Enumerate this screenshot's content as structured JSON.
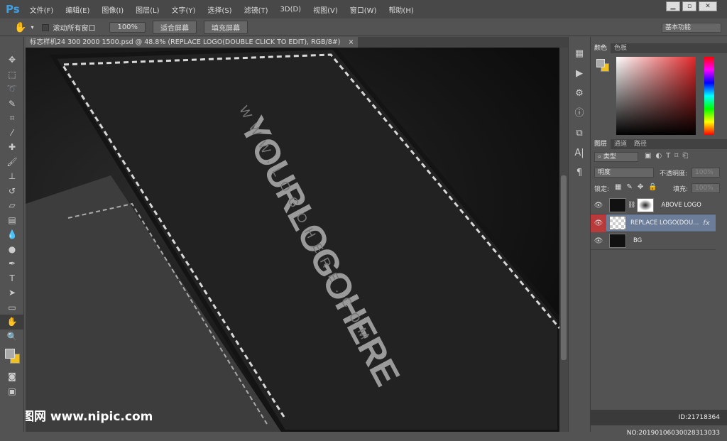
{
  "app": {
    "logo": "Ps"
  },
  "menu": [
    "文件(F)",
    "编辑(E)",
    "图像(I)",
    "图层(L)",
    "文字(Y)",
    "选择(S)",
    "滤镜(T)",
    "3D(D)",
    "视图(V)",
    "窗口(W)",
    "帮助(H)"
  ],
  "window_controls": {
    "minimize": "▁",
    "restore": "▫",
    "close": "✕"
  },
  "options": {
    "scroll_all_label": "滚动所有窗口",
    "zoom100": "100%",
    "fit_screen": "适合屏幕",
    "fill_screen": "填充屏幕",
    "workspace": "基本功能"
  },
  "document_tab": {
    "title": "标志样机24 300 2000 1500.psd @ 48.8% (REPLACE LOGO(DOUBLE CLICK TO EDIT), RGB/8#)",
    "close": "×"
  },
  "canvas": {
    "logo_text": "YOURLOGOHERE",
    "url_text": "WWW.LOGOHERE.COM"
  },
  "color_panel": {
    "tabs": [
      "颜色",
      "色板"
    ]
  },
  "layers_panel": {
    "tabs": [
      "图层",
      "通道",
      "路径"
    ],
    "filter_kind": "类型",
    "blend_mode": "明度",
    "opacity_label": "不透明度:",
    "opacity": "100%",
    "lock_label": "锁定:",
    "fill_label": "填充:",
    "fill": "100%",
    "layers": [
      {
        "name": "ABOVE LOGO",
        "selected": false
      },
      {
        "name": "REPLACE LOGO(DOU...",
        "selected": true,
        "fx": "fx"
      },
      {
        "name": "BG",
        "selected": false
      }
    ]
  },
  "watermark": {
    "site": "昵图网 www.nipic.com",
    "id": "ID:21718364 NO:20190106030028313033"
  }
}
